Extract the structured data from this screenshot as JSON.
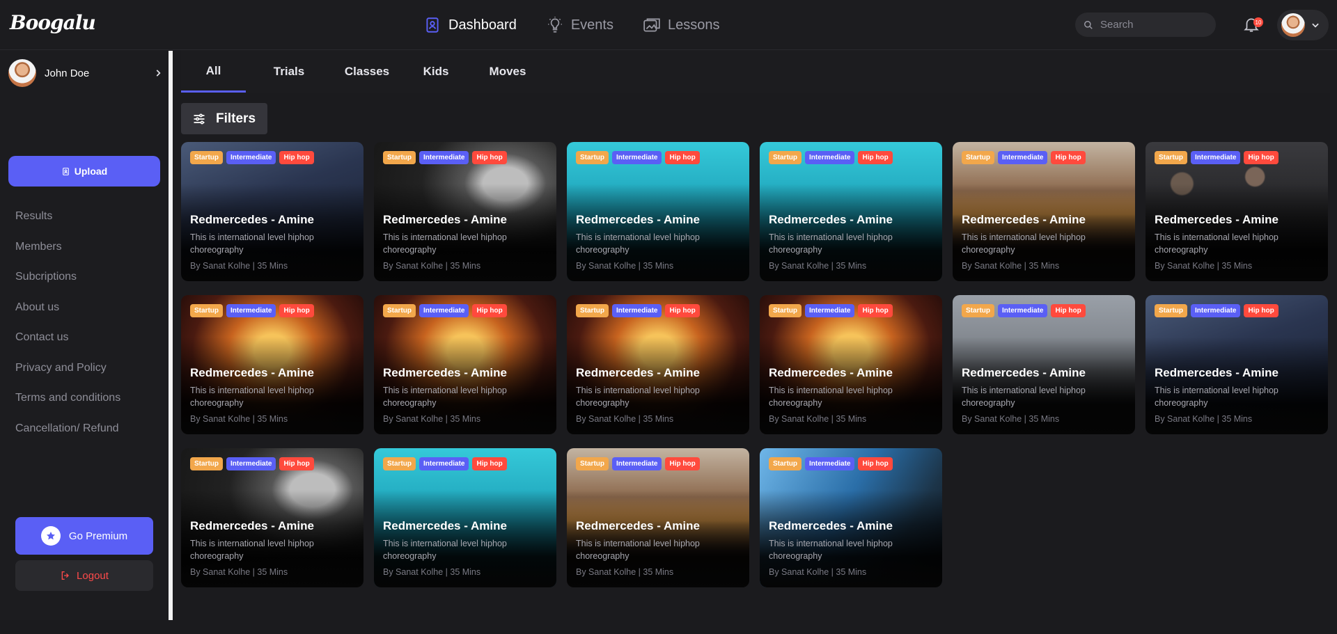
{
  "app": {
    "logo_text": "Boogalu"
  },
  "topnav": {
    "items": [
      {
        "label": "Dashboard",
        "icon": "dashboard-icon",
        "active": true
      },
      {
        "label": "Events",
        "icon": "bulb-icon",
        "active": false
      },
      {
        "label": "Lessons",
        "icon": "lessons-icon",
        "active": false
      }
    ]
  },
  "search": {
    "placeholder": "Search"
  },
  "notifications": {
    "count": "10"
  },
  "sidebar": {
    "user_name": "John Doe",
    "upload_label": "Upload",
    "menu": [
      "Results",
      "Members",
      "Subcriptions",
      "About us",
      "Contact us",
      "Privacy and Policy",
      "Terms and conditions",
      "Cancellation/ Refund"
    ],
    "premium_label": "Go Premium",
    "logout_label": "Logout"
  },
  "tabs": [
    "All",
    "Trials",
    "Classes",
    "Kids",
    "Moves"
  ],
  "filters_label": "Filters",
  "colors": {
    "accent": "#5a5ff5",
    "startup_tag": "#f2a74b",
    "genre_tag": "#ff4a3d",
    "background": "#1b1b1e"
  },
  "cards": [
    {
      "tags": [
        "Startup",
        "Intermediate",
        "Hip hop"
      ],
      "title": "Redmercedes - Amine",
      "desc": "This is international level hiphop choreography",
      "meta": "By Sanat Kolhe | 35 Mins",
      "scene": "wall"
    },
    {
      "tags": [
        "Startup",
        "Intermediate",
        "Hip hop"
      ],
      "title": "Redmercedes - Amine",
      "desc": "This is international level hiphop choreography",
      "meta": "By Sanat Kolhe | 35 Mins",
      "scene": "window"
    },
    {
      "tags": [
        "Startup",
        "Intermediate",
        "Hip hop"
      ],
      "title": "Redmercedes - Amine",
      "desc": "This is international level hiphop choreography",
      "meta": "By Sanat Kolhe | 35 Mins",
      "scene": "cyan"
    },
    {
      "tags": [
        "Startup",
        "Intermediate",
        "Hip hop"
      ],
      "title": "Redmercedes - Amine",
      "desc": "This is international level hiphop choreography",
      "meta": "By Sanat Kolhe | 35 Mins",
      "scene": "cyan"
    },
    {
      "tags": [
        "Startup",
        "Intermediate",
        "Hip hop"
      ],
      "title": "Redmercedes - Amine",
      "desc": "This is international level hiphop choreography",
      "meta": "By Sanat Kolhe | 35 Mins",
      "scene": "street"
    },
    {
      "tags": [
        "Startup",
        "Intermediate",
        "Hip hop"
      ],
      "title": "Redmercedes - Amine",
      "desc": "This is international level hiphop choreography",
      "meta": "By Sanat Kolhe | 35 Mins",
      "scene": "crowd"
    },
    {
      "tags": [
        "Startup",
        "Intermediate",
        "Hip hop"
      ],
      "title": "Redmercedes - Amine",
      "desc": "This is international level hiphop choreography",
      "meta": "By Sanat Kolhe | 35 Mins",
      "scene": "concert"
    },
    {
      "tags": [
        "Startup",
        "Intermediate",
        "Hip hop"
      ],
      "title": "Redmercedes - Amine",
      "desc": "This is international level hiphop choreography",
      "meta": "By Sanat Kolhe | 35 Mins",
      "scene": "concert"
    },
    {
      "tags": [
        "Startup",
        "Intermediate",
        "Hip hop"
      ],
      "title": "Redmercedes - Amine",
      "desc": "This is international level hiphop choreography",
      "meta": "By Sanat Kolhe | 35 Mins",
      "scene": "concert"
    },
    {
      "tags": [
        "Startup",
        "Intermediate",
        "Hip hop"
      ],
      "title": "Redmercedes - Amine",
      "desc": "This is international level hiphop choreography",
      "meta": "By Sanat Kolhe | 35 Mins",
      "scene": "concert"
    },
    {
      "tags": [
        "Startup",
        "Intermediate",
        "Hip hop"
      ],
      "title": "Redmercedes - Amine",
      "desc": "This is international level hiphop choreography",
      "meta": "By Sanat Kolhe | 35 Mins",
      "scene": "grey"
    },
    {
      "tags": [
        "Startup",
        "Intermediate",
        "Hip hop"
      ],
      "title": "Redmercedes - Amine",
      "desc": "This is international level hiphop choreography",
      "meta": "By Sanat Kolhe | 35 Mins",
      "scene": "wall"
    },
    {
      "tags": [
        "Startup",
        "Intermediate",
        "Hip hop"
      ],
      "title": "Redmercedes - Amine",
      "desc": "This is international level hiphop choreography",
      "meta": "By Sanat Kolhe | 35 Mins",
      "scene": "window"
    },
    {
      "tags": [
        "Startup",
        "Intermediate",
        "Hip hop"
      ],
      "title": "Redmercedes - Amine",
      "desc": "This is international level hiphop choreography",
      "meta": "By Sanat Kolhe | 35 Mins",
      "scene": "cyan"
    },
    {
      "tags": [
        "Startup",
        "Intermediate",
        "Hip hop"
      ],
      "title": "Redmercedes - Amine",
      "desc": "This is international level hiphop choreography",
      "meta": "By Sanat Kolhe | 35 Mins",
      "scene": "street"
    },
    {
      "tags": [
        "Startup",
        "Intermediate",
        "Hip hop"
      ],
      "title": "Redmercedes - Amine",
      "desc": "This is international level hiphop choreography",
      "meta": "By Sanat Kolhe | 35 Mins",
      "scene": "city"
    }
  ]
}
